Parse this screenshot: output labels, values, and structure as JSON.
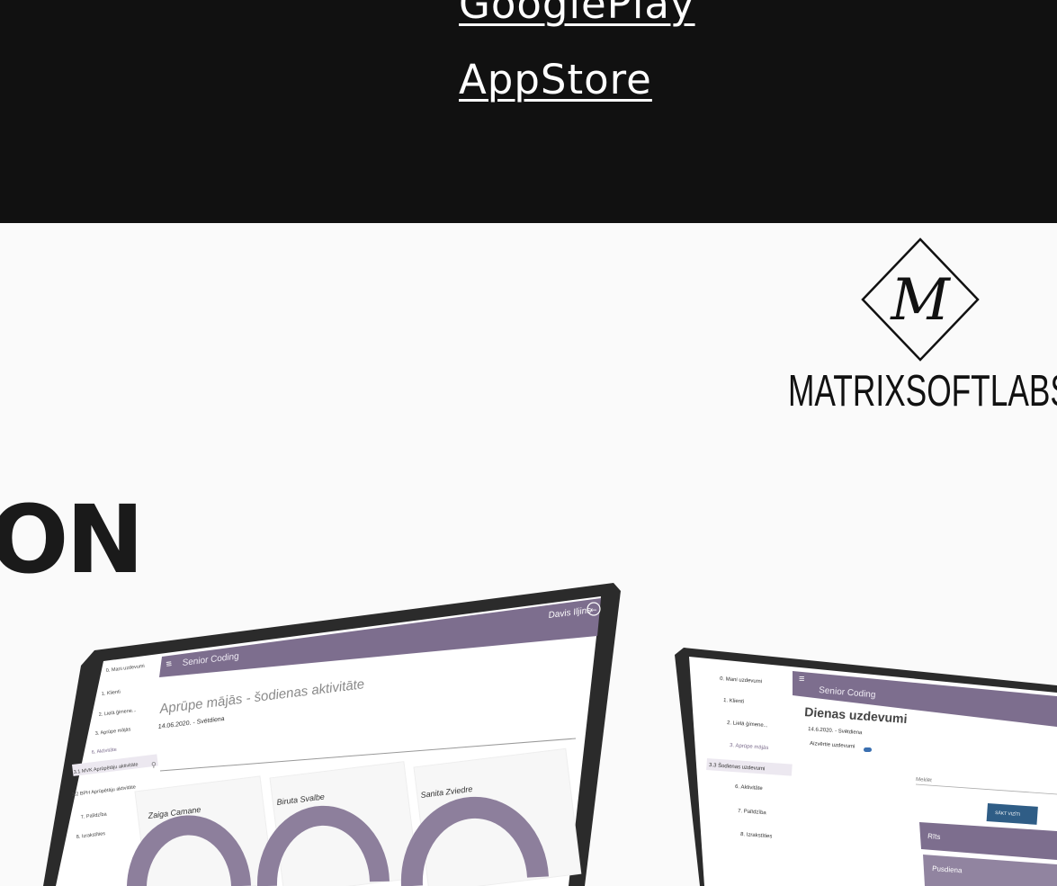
{
  "links": {
    "googleplay": "GooglePlay ",
    "appstore": "AppStore"
  },
  "brand": {
    "logo_letter": "M",
    "name": "MATRIXSOFTLABS"
  },
  "heading_fragment": "ON",
  "colors": {
    "dark_band": "#111111",
    "app_purple": "#7d6e8e",
    "page_bg": "#fafafa"
  },
  "tablet": {
    "app_name": "Senior Coding",
    "user": "Davis Iljins",
    "title": "Aprūpe mājās - šodienas aktivitāte",
    "date": "14.06.2020. - Svētdiena",
    "sidebar": [
      "0. Mani uzdevumi",
      "1. Klienti",
      "2. Lielā ģimene...",
      "3. Aprūpe mājās",
      "6. Aktivitāte",
      "3.1 MVK Aprūpētāju aktivitāte",
      "3.2 BPH Aprūpētāju aktivitāte",
      "7. Palīdzība",
      "8. Izrakstīties"
    ],
    "cards": [
      "Zaiga Camane",
      "Biruta Svalbe",
      "Sanita Zviedre"
    ]
  },
  "laptop": {
    "app_name": "Senior Coding",
    "title": "Dienas uzdevumi",
    "date": "14.6.2020. - Svētdiena",
    "toggle_label": "Aizvērtie uzdevumi",
    "search_placeholder": "Meklēt",
    "start_button": "SĀKT VIZĪTI",
    "sections": [
      "Rīts",
      "Pusdiena"
    ],
    "sidebar": [
      "0. Mani uzdevumi",
      "1. Klienti",
      "2. Lielā ģimene...",
      "3. Aprūpe mājās",
      "3.3 Šodienas uzdevumi",
      "6. Aktivitāte",
      "7. Palīdzība",
      "8. Izrakstīties"
    ]
  }
}
